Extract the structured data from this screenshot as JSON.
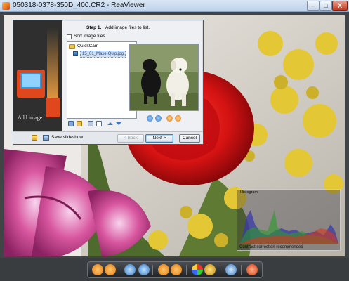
{
  "window": {
    "title": "050318-0378-350D_400.CR2 - ReaViewer",
    "buttons": {
      "minimize": "–",
      "maximize": "□",
      "close": "X"
    }
  },
  "dialog": {
    "promo_label": "Add image",
    "step_label": "Step 1.",
    "step_text": "Add image files to list.",
    "sort_label": "Sort image files",
    "tree": {
      "folder": "QuickCam",
      "file": "15_01_Maxe-Quip.jpg"
    },
    "footer": {
      "save_label": "Save slideshow",
      "back_label": "< Back",
      "next_label": "Next >",
      "cancel_label": "Cancel"
    }
  },
  "histogram": {
    "title": "Histogram",
    "note": "Contrast correction recommended"
  },
  "colors": {
    "accent_orange": "#f08a1c",
    "accent_blue": "#3a8fd8",
    "rose_red": "#d21414"
  },
  "icons": {
    "list_tools": [
      "add-files-icon",
      "add-folder-icon",
      "select-all-icon",
      "remove-icon",
      "move-up-icon",
      "move-down-icon"
    ],
    "preview_tools": [
      "zoom-in-icon",
      "zoom-out-icon",
      "rotate-left-icon",
      "rotate-right-icon"
    ],
    "toolbar": [
      "previous-icon",
      "next-icon",
      "zoom-in-icon",
      "zoom-out-icon",
      "rotate-left-icon",
      "rotate-right-icon",
      "adjust-colors-icon",
      "edit-icon",
      "settings-icon",
      "power-icon"
    ]
  }
}
